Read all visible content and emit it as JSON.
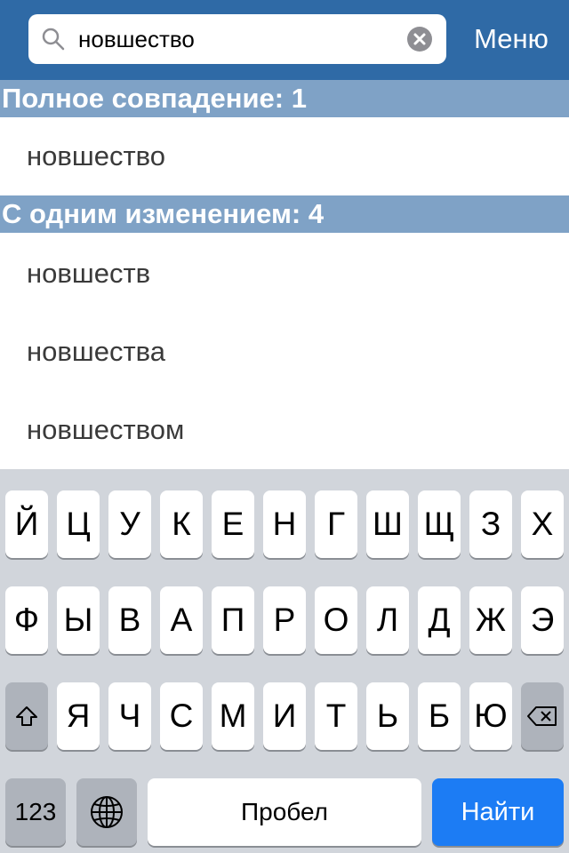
{
  "search": {
    "value": "новшество",
    "menu_label": "Меню"
  },
  "sections": [
    {
      "title": "Полное совпадение: 1",
      "items": [
        "новшество"
      ]
    },
    {
      "title": "С одним изменением: 4",
      "items": [
        "новшеств",
        "новшества",
        "новшеством"
      ]
    }
  ],
  "keyboard": {
    "row1": [
      "Й",
      "Ц",
      "У",
      "К",
      "Е",
      "Н",
      "Г",
      "Ш",
      "Щ",
      "З",
      "Х"
    ],
    "row2": [
      "Ф",
      "Ы",
      "В",
      "А",
      "П",
      "Р",
      "О",
      "Л",
      "Д",
      "Ж",
      "Э"
    ],
    "row3": [
      "Я",
      "Ч",
      "С",
      "М",
      "И",
      "Т",
      "Ь",
      "Б",
      "Ю"
    ],
    "numbers_label": "123",
    "space_label": "Пробел",
    "action_label": "Найти"
  },
  "colors": {
    "navbar": "#2f6aa6",
    "section_header": "#7fa2c6",
    "keyboard_bg": "#d1d5db",
    "action_key": "#1c7cf4"
  },
  "icons": {
    "search": "magnifier-icon",
    "clear": "clear-icon",
    "shift": "shift-icon",
    "backspace": "backspace-icon",
    "globe": "globe-icon"
  }
}
